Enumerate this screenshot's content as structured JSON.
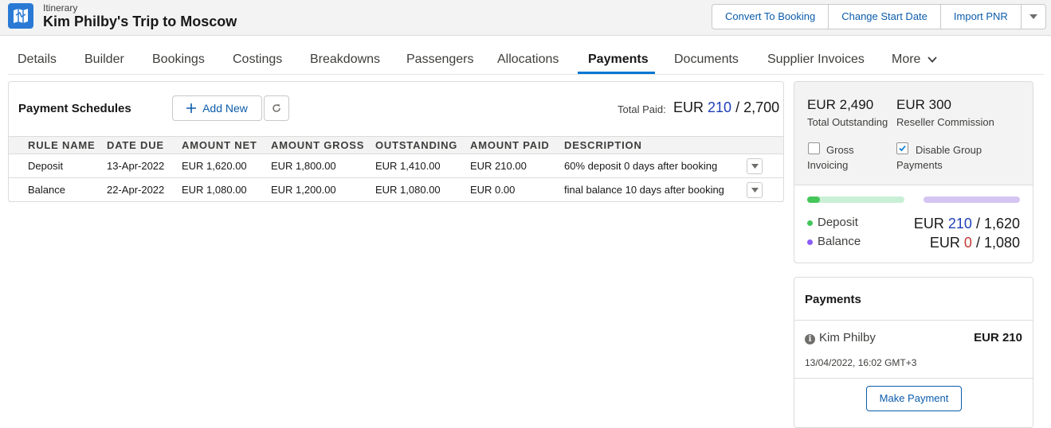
{
  "header": {
    "object_type": "Itinerary",
    "title": "Kim Philby's Trip to Moscow",
    "buttons": [
      "Convert To Booking",
      "Change Start Date",
      "Import PNR"
    ],
    "icon": "itinerary-map-icon"
  },
  "tabs": [
    "Details",
    "Builder",
    "Bookings",
    "Costings",
    "Breakdowns",
    "Passengers",
    "Allocations",
    "Payments",
    "Documents",
    "Supplier Invoices",
    "More"
  ],
  "active_tab": "Payments",
  "schedules": {
    "title": "Payment Schedules",
    "add_new_label": "Add New",
    "total_paid_label": "Total Paid:",
    "total_paid": {
      "currency": "EUR",
      "paid": "210",
      "total": "/ 2,700"
    },
    "columns": [
      "Rule Name",
      "Date Due",
      "Amount Net",
      "Amount Gross",
      "Outstanding",
      "Amount Paid",
      "Description"
    ],
    "rows": [
      {
        "rule": "Deposit",
        "date": "13-Apr-2022",
        "net": "EUR 1,620.00",
        "gross": "EUR 1,800.00",
        "outstanding": "EUR 1,410.00",
        "paid": "EUR 210.00",
        "description": "60% deposit 0 days after booking"
      },
      {
        "rule": "Balance",
        "date": "22-Apr-2022",
        "net": "EUR 1,080.00",
        "gross": "EUR 1,200.00",
        "outstanding": "EUR 1,080.00",
        "paid": "EUR 0.00",
        "description": "final balance 10 days after booking"
      }
    ]
  },
  "summary": {
    "total_outstanding_value": "EUR 2,490",
    "total_outstanding_label": "Total Outstanding",
    "reseller_value": "EUR 300",
    "reseller_label": "Reseller Commission",
    "gross_invoicing_line1": "Gross",
    "gross_invoicing_line2": "Invoicing",
    "gross_invoicing_checked": false,
    "disable_group_line1": "Disable Group",
    "disable_group_line2": "Payments",
    "disable_group_checked": true,
    "deposit_label": "Deposit",
    "deposit_currency": "EUR",
    "deposit_paid": "210",
    "deposit_total": "/ 1,620",
    "deposit_progress": 0.13,
    "balance_label": "Balance",
    "balance_currency": "EUR",
    "balance_paid": "0",
    "balance_total": "/ 1,080",
    "balance_progress": 0,
    "colors": {
      "deposit": "#45c65a",
      "balance": "#8b5cf6"
    }
  },
  "payments": {
    "title": "Payments",
    "payer": "Kim Philby",
    "amount": "EUR 210",
    "timestamp": "13/04/2022, 16:02 GMT+3",
    "make_payment_label": "Make Payment"
  }
}
